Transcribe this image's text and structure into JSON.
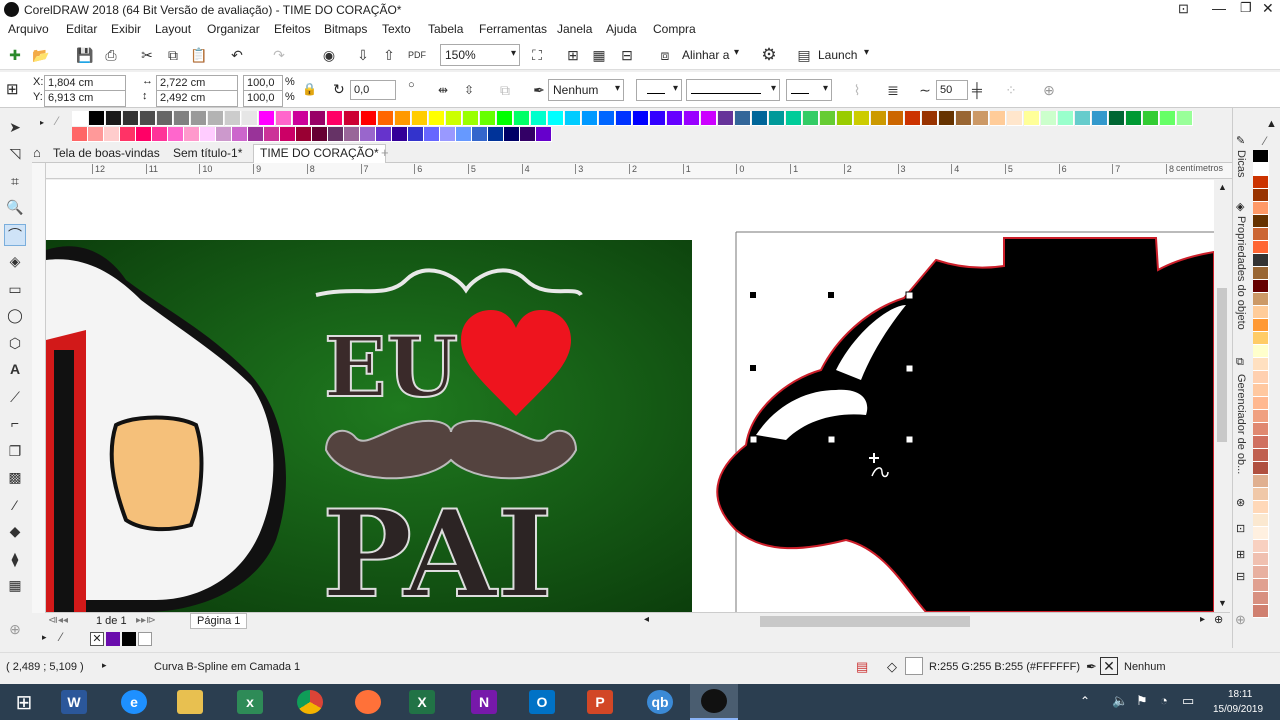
{
  "window": {
    "title": "CorelDRAW 2018 (64 Bit Versão de avaliação) - TIME DO CORAÇÃO*"
  },
  "menu": [
    "Arquivo",
    "Editar",
    "Exibir",
    "Layout",
    "Organizar",
    "Efeitos",
    "Bitmaps",
    "Texto",
    "Tabela",
    "Ferramentas",
    "Janela",
    "Ajuda",
    "Compra"
  ],
  "toolbar": {
    "zoom": "150%",
    "align_label": "Alinhar a",
    "launch_label": "Launch"
  },
  "props": {
    "x": "1,804 cm",
    "y": "6,913 cm",
    "w": "2,722 cm",
    "h": "2,492 cm",
    "scale_w": "100,0",
    "scale_h": "100,0",
    "pct": "%",
    "angle": "0,0",
    "outline": "Nenhum",
    "smooth": "50"
  },
  "tabs": [
    "Tela de boas-vindas",
    "Sem título-1*",
    "TIME DO CORAÇÃO*"
  ],
  "ruler": {
    "unit": "centímetros",
    "ticks": [
      "12",
      "11",
      "10",
      "9",
      "8",
      "7",
      "6",
      "5",
      "4",
      "3",
      "2",
      "1",
      "0",
      "1",
      "2",
      "3",
      "4",
      "5",
      "6",
      "7",
      "8"
    ]
  },
  "artwork": {
    "word1": "EU",
    "word2": "PAI"
  },
  "pager": {
    "page_of": "1  de  1",
    "page_tab": "Página 1"
  },
  "dock": {
    "tab1": "Dicas",
    "tab2": "Propriedades do objeto",
    "tab3": "Gerenciador de ob..."
  },
  "status": {
    "coords": "( 2,489 ; 5,109 )",
    "info": "Curva B-Spline em Camada 1",
    "fill": "R:255 G:255 B:255 (#FFFFFF)",
    "outline": "Nenhum"
  },
  "clock": {
    "time": "18:11",
    "date": "15/09/2019"
  },
  "taskbar": [
    "W",
    "e",
    "",
    "x",
    "",
    "",
    "X",
    "N",
    "O",
    "P",
    "qb",
    ""
  ],
  "palette_top": [
    "#ffffff",
    "#000000",
    "#1a1a1a",
    "#333333",
    "#4d4d4d",
    "#666666",
    "#808080",
    "#999999",
    "#b3b3b3",
    "#cccccc",
    "#e6e6e6",
    "#ff00ff",
    "#ff66cc",
    "#cc0099",
    "#990066",
    "#ff0066",
    "#cc0033",
    "#ff0000",
    "#ff6600",
    "#ff9900",
    "#ffcc00",
    "#ffff00",
    "#ccff00",
    "#99ff00",
    "#66ff00",
    "#00ff00",
    "#00ff66",
    "#00ffcc",
    "#00ffff",
    "#00ccff",
    "#0099ff",
    "#0066ff",
    "#0033ff",
    "#0000ff",
    "#3300ff",
    "#6600ff",
    "#9900ff",
    "#cc00ff",
    "#663399",
    "#336699",
    "#006699",
    "#009999",
    "#00cc99",
    "#33cc66",
    "#66cc33",
    "#99cc00",
    "#cccc00",
    "#cc9900",
    "#cc6600",
    "#cc3300",
    "#993300",
    "#663300",
    "#996633",
    "#cc9966",
    "#ffcc99",
    "#ffe6cc",
    "#ffff99",
    "#ccffcc",
    "#99ffcc",
    "#66cccc",
    "#3399cc",
    "#006633",
    "#009933",
    "#33cc33",
    "#66ff66",
    "#99ff99"
  ],
  "palette_bottom": [
    "#ff6666",
    "#ff9999",
    "#ffcccc",
    "#ff3366",
    "#ff0066",
    "#ff3399",
    "#ff66cc",
    "#ff99cc",
    "#ffccff",
    "#cc99cc",
    "#cc66cc",
    "#993399",
    "#cc3399",
    "#cc0066",
    "#990033",
    "#660033",
    "#663366",
    "#996699",
    "#9966cc",
    "#6633cc",
    "#330099",
    "#3333cc",
    "#6666ff",
    "#9999ff",
    "#6699ff",
    "#3366cc",
    "#003399",
    "#000066",
    "#330066",
    "#6600cc"
  ],
  "palette_right": [
    "#000000",
    "#ffffff",
    "#cc3300",
    "#993300",
    "#ff9966",
    "#663300",
    "#cc6633",
    "#ff6633",
    "#333333",
    "#996633",
    "#660000",
    "#cc9966",
    "#ffcc99",
    "#ff9933",
    "#ffcc66",
    "#ffffcc",
    "#ffe0c0",
    "#ffd0b0",
    "#ffc8a0",
    "#ffb890",
    "#f0a080",
    "#e08870",
    "#d07060",
    "#c06050",
    "#b05040",
    "#e0b090",
    "#f0c8a8",
    "#ffd8b8",
    "#fbe8d0",
    "#fff0e0",
    "#f8d0c0",
    "#f0c0b0",
    "#e8b0a0",
    "#e0a090",
    "#d89080",
    "#d08070"
  ]
}
